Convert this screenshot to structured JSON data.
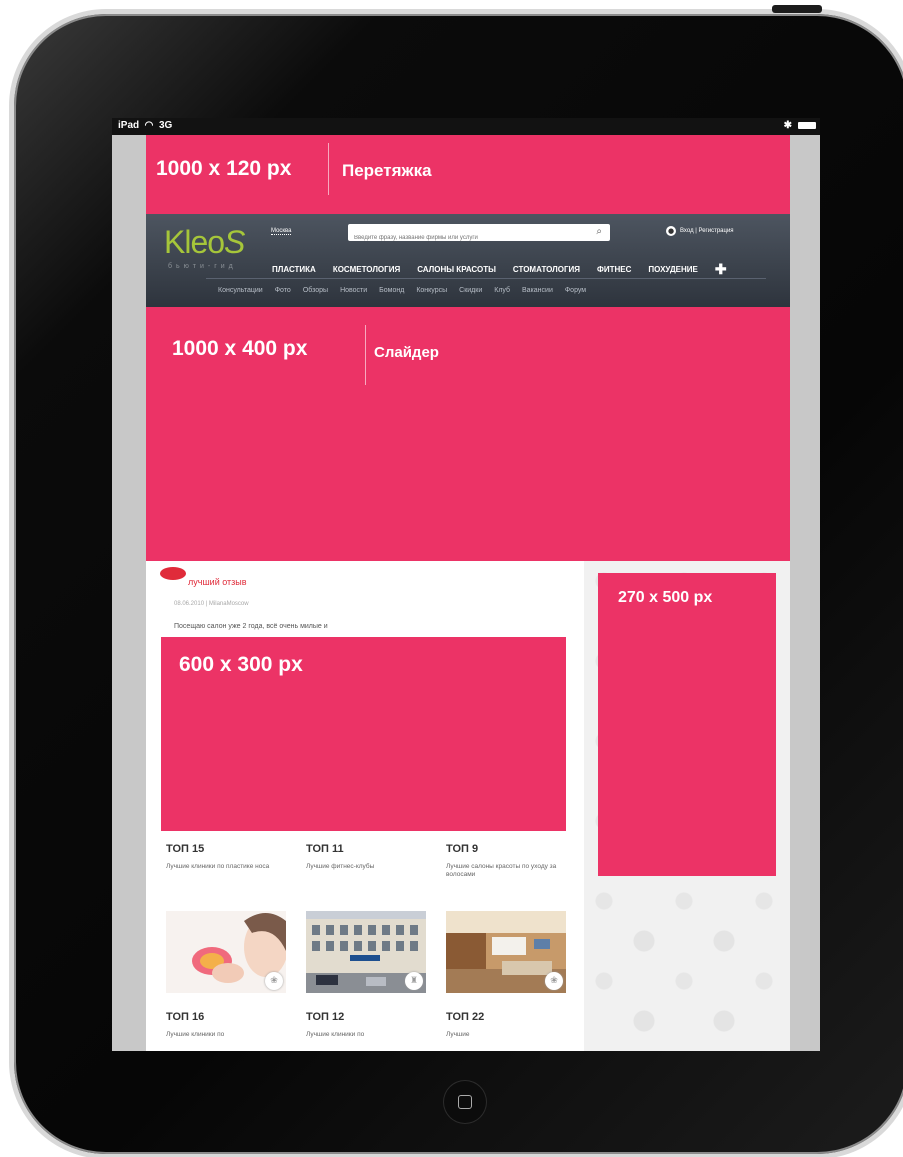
{
  "statusbar": {
    "device": "iPad",
    "network": "3G",
    "bluetooth": "✱"
  },
  "banner": {
    "size": "1000 x 120 px",
    "label": "Перетяжка"
  },
  "header": {
    "logo": "Kleo",
    "logo_tail": "S",
    "logo_sub": "бьюти-гид",
    "city": "Москва",
    "search_placeholder": "Введите фразу, название фирмы или услуги",
    "auth": "Вход | Регистрация",
    "main_nav": [
      "ПЛАСТИКА",
      "КОСМЕТОЛОГИЯ",
      "САЛОНЫ КРАСОТЫ",
      "СТОМАТОЛОГИЯ",
      "ФИТНЕС",
      "ПОХУДЕНИЕ"
    ],
    "sub_nav": [
      "Консультации",
      "Фото",
      "Обзоры",
      "Новости",
      "Бомонд",
      "Конкурсы",
      "Скидки",
      "Клуб",
      "Вакансии",
      "Форум"
    ]
  },
  "slider": {
    "size": "1000 x 400 px",
    "label": "Слайдер"
  },
  "review": {
    "title": "лучший отзыв",
    "meta": "08.06.2010 | MilanaMoscow",
    "text": "Посещаю салон уже 2 года, всё очень милые и"
  },
  "ad_600": {
    "size": "600 x 300 px"
  },
  "ad_270": {
    "size": "270 x 500 px"
  },
  "tops_row1": [
    {
      "title": "ТОП 15",
      "desc": "Лучшие клиники по пластике носа"
    },
    {
      "title": "ТОП 11",
      "desc": "Лучшие фитнес-клубы"
    },
    {
      "title": "ТОП 9",
      "desc": "Лучшие салоны красоты по уходу за волосами"
    }
  ],
  "tops_row2": [
    {
      "title": "ТОП 16",
      "desc": "Лучшие клиники по"
    },
    {
      "title": "ТОП 12",
      "desc": "Лучшие клиники по"
    },
    {
      "title": "ТОП 22",
      "desc": "Лучшие"
    }
  ],
  "colors": {
    "accent": "#ec3366",
    "header": "#3a414b",
    "logo": "#a6c63a",
    "review_red": "#e02b3a"
  }
}
